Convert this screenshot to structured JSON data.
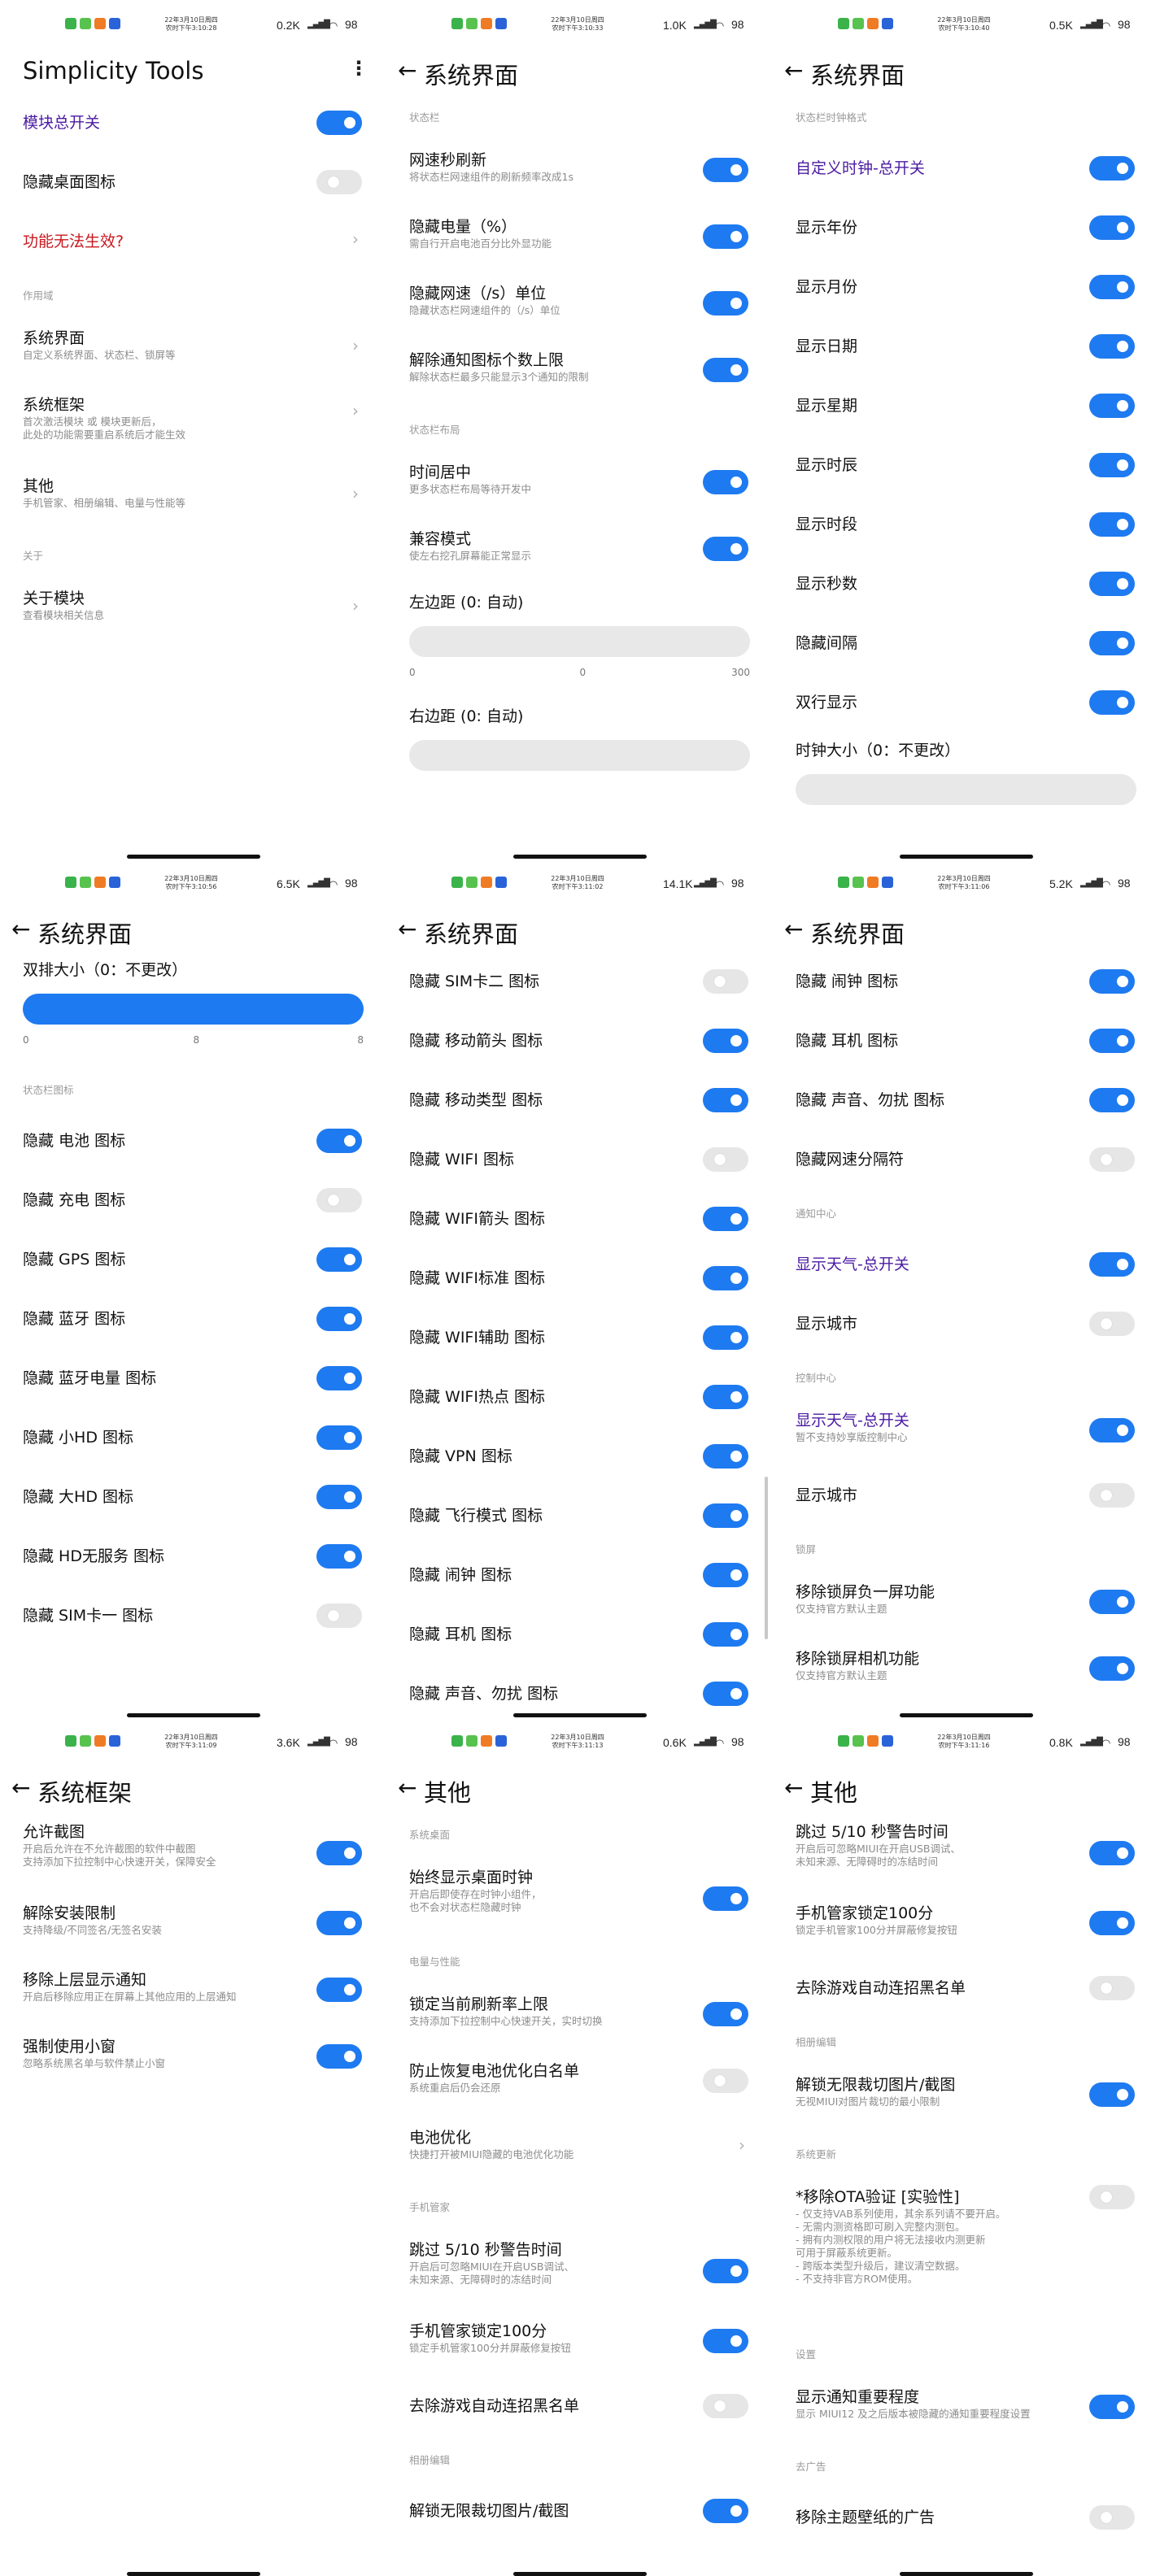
{
  "colors": {
    "toggle_on": "#1e7af0",
    "toggle_off": "#e6e6e6",
    "accent_purple": "#4a1aa2",
    "warning_red": "#c8181f",
    "section_grey": "#9a9a9a"
  },
  "panels": [
    {
      "status": {
        "date": "22年3月10日周四",
        "time": "农时下午3:10:28",
        "speed": "0.2K",
        "battery": "98"
      },
      "title": "Simplicity Tools",
      "back": false,
      "menu": true,
      "rows": [
        {
          "kind": "toggle",
          "title": "模块总开关",
          "on": true,
          "style": "pur"
        },
        {
          "kind": "toggle",
          "title": "隐藏桌面图标",
          "on": false
        },
        {
          "kind": "link",
          "title": "功能无法生效?",
          "style": "red"
        },
        {
          "kind": "sec",
          "title": "作用域"
        },
        {
          "kind": "link",
          "title": "系统界面",
          "sub": "自定义系统界面、状态栏、锁屏等"
        },
        {
          "kind": "link",
          "title": "系统框架",
          "sub": "首次激活模块 或 模块更新后，\n此处的功能需要重启系统后才能生效"
        },
        {
          "kind": "link",
          "title": "其他",
          "sub": "手机管家、相册编辑、电量与性能等"
        },
        {
          "kind": "sec",
          "title": "关于"
        },
        {
          "kind": "link",
          "title": "关于模块",
          "sub": "查看模块相关信息"
        }
      ]
    },
    {
      "status": {
        "date": "22年3月10日周四",
        "time": "农时下午3:10:33",
        "speed": "1.0K",
        "battery": "98"
      },
      "title": "系统界面",
      "back": true,
      "rows": [
        {
          "kind": "sec",
          "title": "状态栏"
        },
        {
          "kind": "toggle",
          "title": "网速秒刷新",
          "sub": "将状态栏网速组件的刷新频率改成1s",
          "on": true
        },
        {
          "kind": "toggle",
          "title": "隐藏电量（%）",
          "sub": "需自行开启电池百分比外显功能",
          "on": true
        },
        {
          "kind": "toggle",
          "title": "隐藏网速（/s）单位",
          "sub": "隐藏状态栏网速组件的（/s）单位",
          "on": true
        },
        {
          "kind": "toggle",
          "title": "解除通知图标个数上限",
          "sub": "解除状态栏最多只能显示3个通知的限制",
          "on": true
        },
        {
          "kind": "sec",
          "title": "状态栏布局"
        },
        {
          "kind": "toggle",
          "title": "时间居中",
          "sub": "更多状态栏布局等待开发中",
          "on": true
        },
        {
          "kind": "toggle",
          "title": "兼容模式",
          "sub": "使左右挖孔屏幕能正常显示",
          "on": true
        },
        {
          "kind": "slider",
          "title": "左边距 (0: 自动)",
          "ticks": [
            "0",
            "0",
            "300"
          ],
          "fill": false
        },
        {
          "kind": "slider",
          "title": "右边距 (0: 自动)",
          "ticks": [],
          "fill": false
        }
      ]
    },
    {
      "status": {
        "date": "22年3月10日周四",
        "time": "农时下午3:10:40",
        "speed": "0.5K",
        "battery": "98"
      },
      "title": "系统界面",
      "back": true,
      "rows": [
        {
          "kind": "sec",
          "title": "状态栏时钟格式"
        },
        {
          "kind": "toggle",
          "title": "自定义时钟-总开关",
          "on": true,
          "style": "pur"
        },
        {
          "kind": "toggle",
          "title": "显示年份",
          "on": true
        },
        {
          "kind": "toggle",
          "title": "显示月份",
          "on": true
        },
        {
          "kind": "toggle",
          "title": "显示日期",
          "on": true
        },
        {
          "kind": "toggle",
          "title": "显示星期",
          "on": true
        },
        {
          "kind": "toggle",
          "title": "显示时辰",
          "on": true
        },
        {
          "kind": "toggle",
          "title": "显示时段",
          "on": true
        },
        {
          "kind": "toggle",
          "title": "显示秒数",
          "on": true
        },
        {
          "kind": "toggle",
          "title": "隐藏间隔",
          "on": true
        },
        {
          "kind": "toggle",
          "title": "双行显示",
          "on": true
        },
        {
          "kind": "slider",
          "title": "时钟大小（0：不更改）",
          "ticks": [],
          "fill": false
        }
      ]
    },
    {
      "status": {
        "date": "22年3月10日周四",
        "time": "农时下午3:10:56",
        "speed": "6.5K",
        "battery": "98"
      },
      "title": "系统界面",
      "back": true,
      "rows": [
        {
          "kind": "slider",
          "title": "双排大小（0：不更改）",
          "ticks": [
            "0",
            "8",
            "8"
          ],
          "fill": true,
          "level": 1.0
        },
        {
          "kind": "sec",
          "title": "状态栏图标"
        },
        {
          "kind": "toggle",
          "title": "隐藏 电池 图标",
          "on": true
        },
        {
          "kind": "toggle",
          "title": "隐藏 充电 图标",
          "on": false
        },
        {
          "kind": "toggle",
          "title": "隐藏 GPS 图标",
          "on": true
        },
        {
          "kind": "toggle",
          "title": "隐藏 蓝牙 图标",
          "on": true
        },
        {
          "kind": "toggle",
          "title": "隐藏 蓝牙电量 图标",
          "on": true
        },
        {
          "kind": "toggle",
          "title": "隐藏 小HD 图标",
          "on": true
        },
        {
          "kind": "toggle",
          "title": "隐藏 大HD 图标",
          "on": true
        },
        {
          "kind": "toggle",
          "title": "隐藏 HD无服务 图标",
          "on": true
        },
        {
          "kind": "toggle",
          "title": "隐藏 SIM卡一 图标",
          "on": false
        }
      ]
    },
    {
      "status": {
        "date": "22年3月10日周四",
        "time": "农时下午3:11:02",
        "speed": "14.1K",
        "battery": "98"
      },
      "title": "系统界面",
      "back": true,
      "rows": [
        {
          "kind": "toggle",
          "title": "隐藏 SIM卡二 图标",
          "on": false
        },
        {
          "kind": "toggle",
          "title": "隐藏 移动箭头 图标",
          "on": true
        },
        {
          "kind": "toggle",
          "title": "隐藏 移动类型 图标",
          "on": true
        },
        {
          "kind": "toggle",
          "title": "隐藏 WIFI 图标",
          "on": false
        },
        {
          "kind": "toggle",
          "title": "隐藏 WIFI箭头 图标",
          "on": true
        },
        {
          "kind": "toggle",
          "title": "隐藏 WIFI标准 图标",
          "on": true
        },
        {
          "kind": "toggle",
          "title": "隐藏 WIFI辅助 图标",
          "on": true
        },
        {
          "kind": "toggle",
          "title": "隐藏 WIFI热点 图标",
          "on": true
        },
        {
          "kind": "toggle",
          "title": "隐藏 VPN 图标",
          "on": true
        },
        {
          "kind": "toggle",
          "title": "隐藏 飞行模式 图标",
          "on": true
        },
        {
          "kind": "toggle",
          "title": "隐藏 闹钟 图标",
          "on": true
        },
        {
          "kind": "toggle",
          "title": "隐藏 耳机 图标",
          "on": true
        },
        {
          "kind": "toggle",
          "title": "隐藏 声音、勿扰 图标",
          "on": true
        }
      ]
    },
    {
      "status": {
        "date": "22年3月10日周四",
        "time": "农时下午3:11:06",
        "speed": "5.2K",
        "battery": "98"
      },
      "title": "系统界面",
      "back": true,
      "rows": [
        {
          "kind": "toggle",
          "title": "隐藏 闹钟 图标",
          "on": true
        },
        {
          "kind": "toggle",
          "title": "隐藏 耳机 图标",
          "on": true
        },
        {
          "kind": "toggle",
          "title": "隐藏 声音、勿扰 图标",
          "on": true
        },
        {
          "kind": "toggle",
          "title": "隐藏网速分隔符",
          "on": false
        },
        {
          "kind": "sec",
          "title": "通知中心"
        },
        {
          "kind": "toggle",
          "title": "显示天气-总开关",
          "on": true,
          "style": "pur"
        },
        {
          "kind": "toggle",
          "title": "显示城市",
          "on": false
        },
        {
          "kind": "sec",
          "title": "控制中心"
        },
        {
          "kind": "toggle",
          "title": "显示天气-总开关",
          "sub": "暂不支持妙享版控制中心",
          "on": true,
          "style": "pur"
        },
        {
          "kind": "toggle",
          "title": "显示城市",
          "on": false
        },
        {
          "kind": "sec",
          "title": "锁屏"
        },
        {
          "kind": "toggle",
          "title": "移除锁屏负一屏功能",
          "sub": "仅支持官方默认主题",
          "on": true
        },
        {
          "kind": "toggle",
          "title": "移除锁屏相机功能",
          "sub": "仅支持官方默认主题",
          "on": true
        }
      ]
    },
    {
      "status": {
        "date": "22年3月10日周四",
        "time": "农时下午3:11:09",
        "speed": "3.6K",
        "battery": "98"
      },
      "title": "系统框架",
      "back": true,
      "rows": [
        {
          "kind": "toggle",
          "title": "允许截图",
          "sub": "开启后允许在不允许截图的软件中截图\n支持添加下拉控制中心快速开关，保障安全",
          "on": true
        },
        {
          "kind": "toggle",
          "title": "解除安装限制",
          "sub": "支持降级/不同签名/无签名安装",
          "on": true
        },
        {
          "kind": "toggle",
          "title": "移除上层显示通知",
          "sub": "开启后移除应用正在屏幕上其他应用的上层通知",
          "on": true
        },
        {
          "kind": "toggle",
          "title": "强制使用小窗",
          "sub": "忽略系统黑名单与软件禁止小窗",
          "on": true
        }
      ]
    },
    {
      "status": {
        "date": "22年3月10日周四",
        "time": "农时下午3:11:13",
        "speed": "0.6K",
        "battery": "98"
      },
      "title": "其他",
      "back": true,
      "rows": [
        {
          "kind": "sec",
          "title": "系统桌面"
        },
        {
          "kind": "toggle",
          "title": "始终显示桌面时钟",
          "sub": "开启后即使存在时钟小组件，\n也不会对状态栏隐藏时钟",
          "on": true
        },
        {
          "kind": "sec",
          "title": "电量与性能"
        },
        {
          "kind": "toggle",
          "title": "锁定当前刷新率上限",
          "sub": "支持添加下拉控制中心快速开关，实时切换",
          "on": true
        },
        {
          "kind": "toggle",
          "title": "防止恢复电池优化白名单",
          "sub": "系统重启后仍会还原",
          "on": false
        },
        {
          "kind": "link",
          "title": "电池优化",
          "sub": "快捷打开被MIUI隐藏的电池优化功能"
        },
        {
          "kind": "sec",
          "title": "手机管家"
        },
        {
          "kind": "toggle",
          "title": "跳过 5/10 秒警告时间",
          "sub": "开启后可忽略MIUI在开启USB调试、\n未知来源、无障碍时的冻结时间",
          "on": true
        },
        {
          "kind": "toggle",
          "title": "手机管家锁定100分",
          "sub": "锁定手机管家100分并屏蔽修复按钮",
          "on": true
        },
        {
          "kind": "toggle",
          "title": "去除游戏自动连招黑名单",
          "on": false
        },
        {
          "kind": "sec",
          "title": "相册编辑"
        },
        {
          "kind": "toggle",
          "title": "解锁无限裁切图片/截图",
          "on": true
        }
      ]
    },
    {
      "status": {
        "date": "22年3月10日周四",
        "time": "农时下午3:11:16",
        "speed": "0.8K",
        "battery": "98"
      },
      "title": "其他",
      "back": true,
      "rows": [
        {
          "kind": "toggle",
          "title": "跳过 5/10 秒警告时间",
          "sub": "开启后可忽略MIUI在开启USB调试、\n未知来源、无障碍时的冻结时间",
          "on": true
        },
        {
          "kind": "toggle",
          "title": "手机管家锁定100分",
          "sub": "锁定手机管家100分并屏蔽修复按钮",
          "on": true
        },
        {
          "kind": "toggle",
          "title": "去除游戏自动连招黑名单",
          "on": false
        },
        {
          "kind": "sec",
          "title": "相册编辑"
        },
        {
          "kind": "toggle",
          "title": "解锁无限裁切图片/截图",
          "sub": "无视MIUI对图片裁切的最小限制",
          "on": true
        },
        {
          "kind": "sec",
          "title": "系统更新"
        },
        {
          "kind": "toggle",
          "title": "*移除OTA验证 [实验性]",
          "sub": "- 仅支持VAB系列使用，其余系列请不要开启。\n- 无需内测资格即可刷入完整内测包。\n- 拥有内测权限的用户将无法接收内测更新\n可用于屏蔽系统更新。\n- 跨版本类型升级后，建议清空数据。\n- 不支持非官方ROM使用。",
          "on": false,
          "tall": true
        },
        {
          "kind": "sec",
          "title": "设置"
        },
        {
          "kind": "toggle",
          "title": "显示通知重要程度",
          "sub": "显示 MIUI12 及之后版本被隐藏的通知重要程度设置",
          "on": true
        },
        {
          "kind": "sec",
          "title": "去广告"
        },
        {
          "kind": "toggle",
          "title": "移除主题壁纸的广告",
          "on": false
        }
      ]
    }
  ]
}
